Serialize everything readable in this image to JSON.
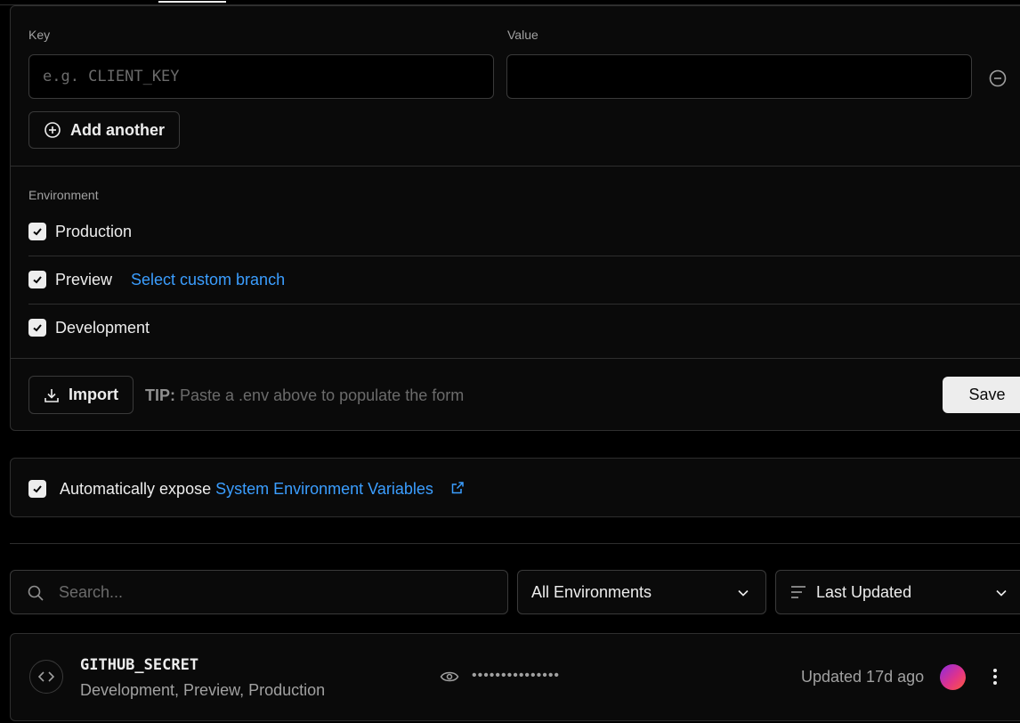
{
  "form": {
    "key_label": "Key",
    "value_label": "Value",
    "key_placeholder": "e.g. CLIENT_KEY",
    "key_value": "",
    "value_value": "",
    "add_another_label": "Add another",
    "environment_label": "Environment",
    "environments": [
      {
        "label": "Production",
        "checked": true
      },
      {
        "label": "Preview",
        "checked": true,
        "link": "Select custom branch"
      },
      {
        "label": "Development",
        "checked": true
      }
    ],
    "import_label": "Import",
    "tip_prefix": "TIP:",
    "tip_text": " Paste a .env above to populate the form",
    "save_label": "Save"
  },
  "expose": {
    "checked": true,
    "text": "Automatically expose ",
    "link": "System Environment Variables"
  },
  "filters": {
    "search_placeholder": "Search...",
    "environment_select": "All Environments",
    "sort_select": "Last Updated"
  },
  "variables": [
    {
      "name": "GITHUB_SECRET",
      "environments": "Development, Preview, Production",
      "masked_value": "•••••••••••••••",
      "updated": "Updated 17d ago"
    }
  ],
  "colors": {
    "link": "#3b9eff",
    "background": "#000000",
    "card": "#0a0a0a",
    "border": "#2e2e2e"
  }
}
